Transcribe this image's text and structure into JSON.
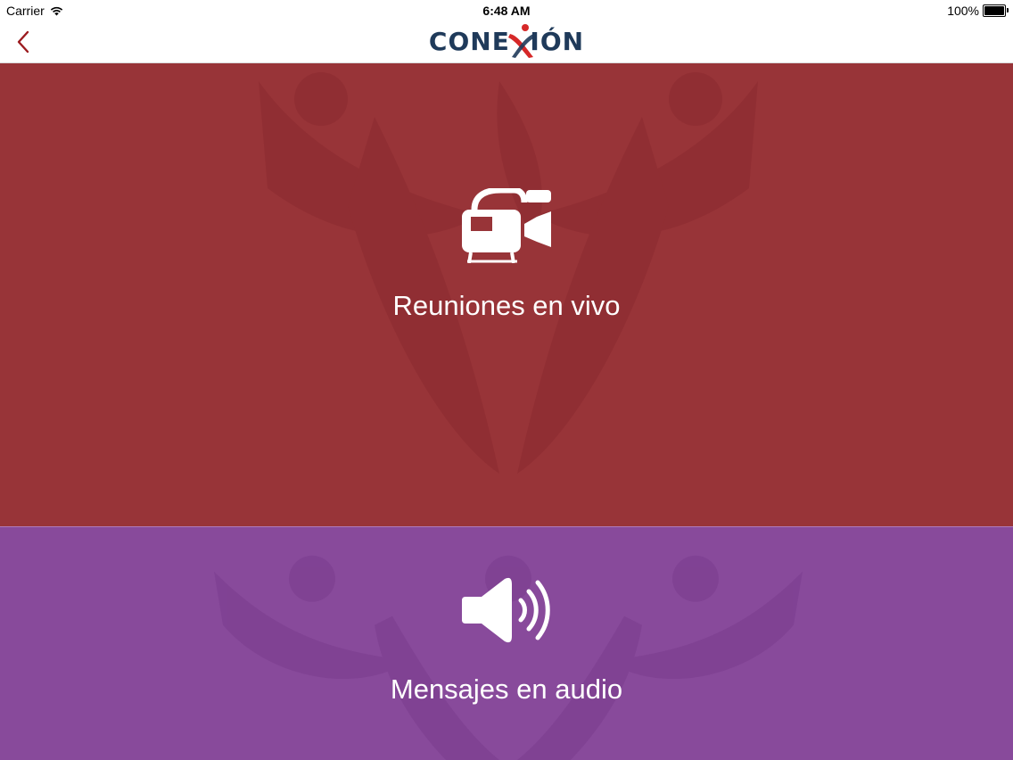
{
  "status_bar": {
    "carrier": "Carrier",
    "time": "6:48 AM",
    "battery": "100%",
    "battery_level": 1.0
  },
  "nav_bar": {
    "back_icon": "chevron-left-icon",
    "logo": {
      "before_x": "CONE",
      "x": "X",
      "after_x": "IÓN"
    },
    "accent_color": "#9c1b1f",
    "logo_color": "#1f3a5a"
  },
  "panels": [
    {
      "label": "Reuniones en vivo",
      "icon": "video-camera-icon",
      "color": "#983438"
    },
    {
      "label": "Mensajes en audio",
      "icon": "speaker-volume-icon",
      "color": "#884a9b"
    }
  ]
}
